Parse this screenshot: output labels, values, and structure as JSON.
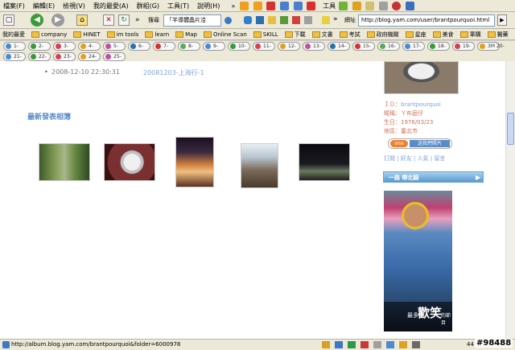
{
  "menu": [
    "檔案(F)",
    "編輯(E)",
    "檢視(V)",
    "我的最愛(A)",
    "群組(G)",
    "工具(T)",
    "說明(H)"
  ],
  "toolbar": {
    "search_label": "搜尋",
    "search_value": "「半導體晶片洽",
    "tools_label": "工具",
    "address_label": "網址",
    "address_value": "http://blog.yam.com/user/brantpourquoi.html"
  },
  "favorites": {
    "title": "我的最愛",
    "items": [
      "company",
      "HINET",
      "im tools",
      "learn",
      "Map",
      "Online Scan",
      "SKILL",
      "下載",
      "文書",
      "考試",
      "政府機關",
      "星座",
      "美食",
      "軍購",
      "醫藥"
    ]
  },
  "tabs_row1": [
    "1-",
    "2-",
    "3-",
    "4-",
    "5-",
    "6-",
    "7-",
    "8-",
    "9-",
    "10-",
    "11-",
    "12-",
    "13-",
    "14-",
    "15-",
    "16-",
    "17-",
    "18-",
    "19-",
    "3M 20-"
  ],
  "tabs_row2": [
    "21-",
    "22-",
    "23-",
    "24-",
    "25-"
  ],
  "post": {
    "date": "2008-12-10 22:30:31",
    "link": "20081203-上海行-1"
  },
  "album": {
    "heading": "最新發表相簿"
  },
  "profile": {
    "id_label": "ＩＤ：",
    "id_value": "brantpourquoi",
    "nick_label": "暱稱：",
    "nick_value": "Ｙ布庭仔",
    "bday_label": "生日：",
    "bday_value": "1976/03/23",
    "area_label": "地區：",
    "area_value": "臺北市",
    "links": "訂閱 | 好友 | 人氣 | 留言",
    "ime_badge": "送我們照片"
  },
  "sidebar_ad": {
    "banner": "一路 帶北騎",
    "caption_small": "最多",
    "caption_big": "歡笑",
    "caption_tail": "的節目"
  },
  "status": {
    "url": "http://album.blog.yam.com/brantpourquoi&folder=6000978",
    "zoom": "44"
  },
  "watermark": "#98488",
  "colors": {
    "link": "#7fa3d9",
    "heading": "#5a8cc8",
    "profile_text": "#d7705a"
  }
}
